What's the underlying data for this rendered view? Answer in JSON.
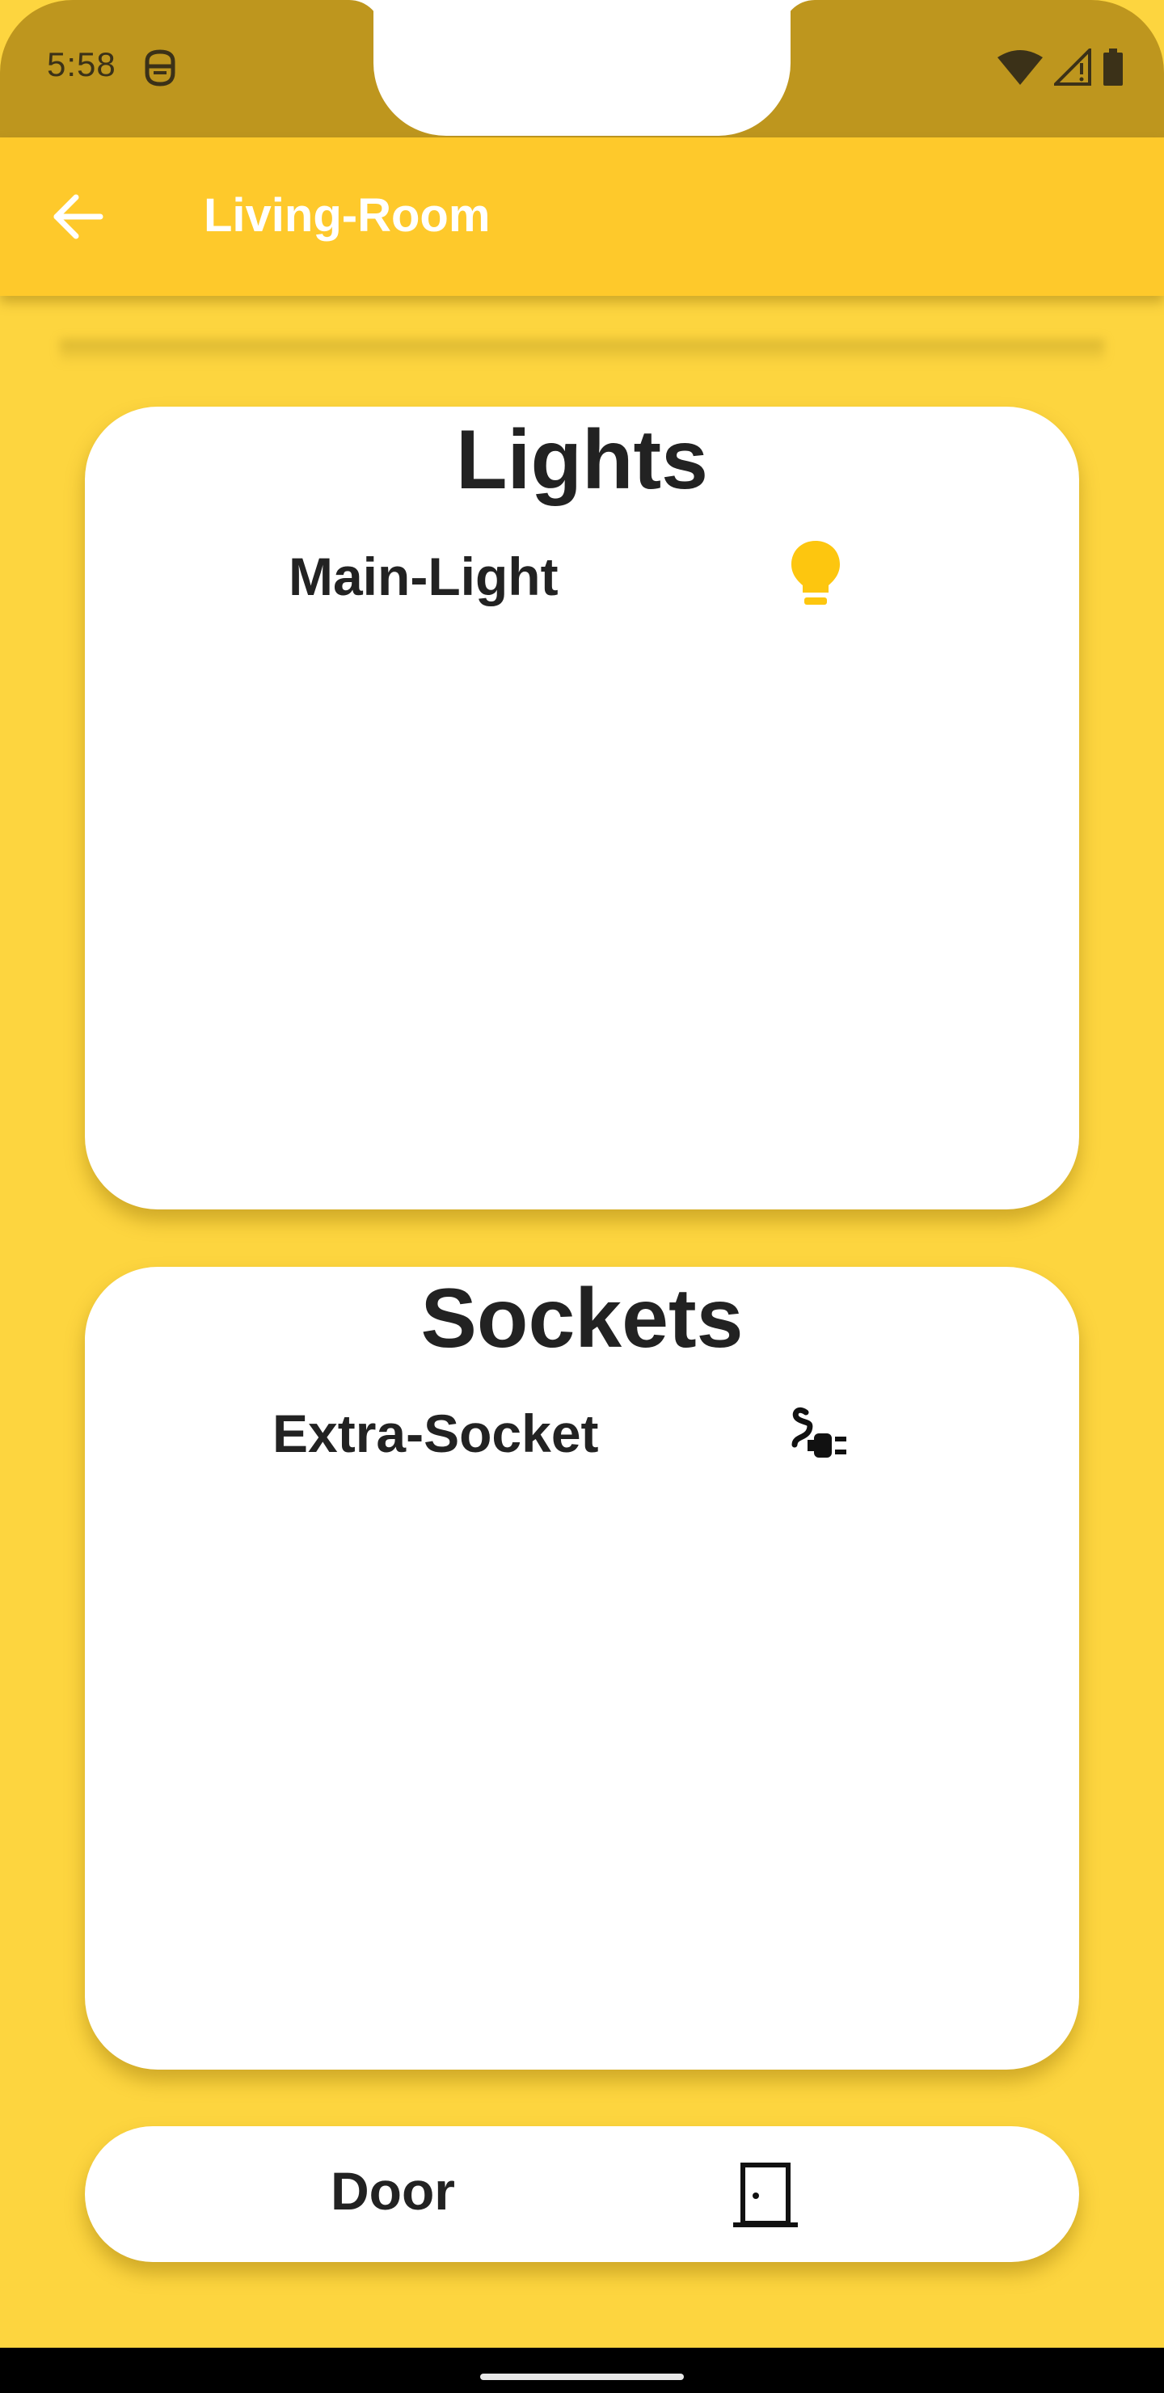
{
  "status_bar": {
    "time": "5:58",
    "app_icon": "android-debug-icon",
    "icons": [
      "wifi-icon",
      "cell-signal-icon",
      "battery-icon"
    ]
  },
  "app_bar": {
    "back_icon": "arrow-back-icon",
    "title": "Living-Room"
  },
  "colors": {
    "background": "#FDD53F",
    "app_bar": "#FEC92B",
    "status_bar": "#BE961E",
    "card": "#FFFFFF",
    "light_on": "#FDC60F",
    "text": "#222222"
  },
  "sections": {
    "lights": {
      "title": "Lights",
      "devices": [
        {
          "label": "Main-Light",
          "icon": "lightbulb-icon",
          "state": "on"
        }
      ]
    },
    "sockets": {
      "title": "Sockets",
      "devices": [
        {
          "label": "Extra-Socket",
          "icon": "power-plug-icon"
        }
      ]
    },
    "door": {
      "label": "Door",
      "icon": "door-icon"
    }
  }
}
